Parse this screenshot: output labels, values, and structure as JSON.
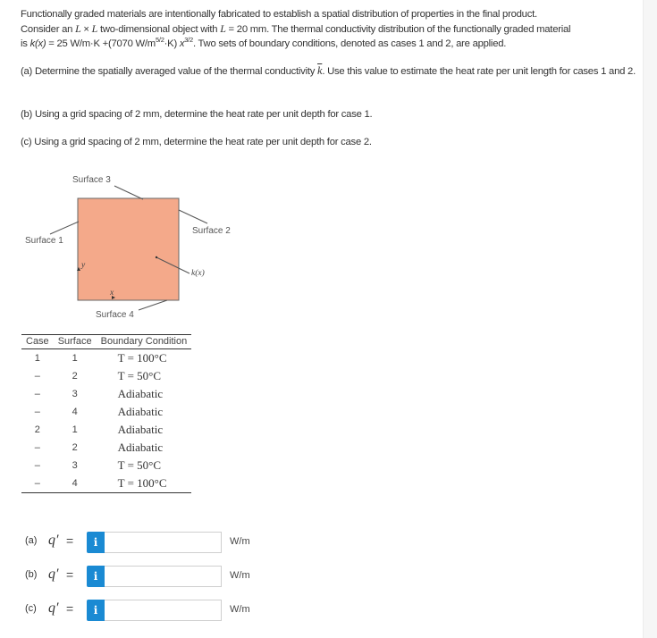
{
  "problem": {
    "intro_line1": "Functionally graded materials are intentionally fabricated to establish a spatial distribution of properties in the final product.",
    "intro_line2_a": "Consider an ",
    "intro_L": "L",
    "intro_times": " × ",
    "intro_L2": "L",
    "intro_line2_b": " two-dimensional object with ",
    "intro_L3": "L",
    "intro_line2_c": " = 20 mm. The thermal conductivity distribution of the functionally graded material",
    "intro_line3_a": "is ",
    "intro_kx": "k(x)",
    "intro_line3_b": " = 25 W/m·K +(7070 W/m",
    "intro_sup1": "5/2",
    "intro_line3_c": "·K) ",
    "intro_x": "x",
    "intro_sup2": "3/2",
    "intro_line3_d": ". Two sets of boundary conditions, denoted as cases 1 and 2, are applied.",
    "part_a_1": "(a) Determine the spatially averaged value of the thermal conductivity ",
    "part_a_k": "k",
    "part_a_2": ". Use this value to estimate the heat rate per unit length for cases 1 and 2.",
    "part_b": "(b) Using a grid spacing of 2 mm, determine the heat rate per unit depth for case 1.",
    "part_c": "(c) Using a grid spacing of 2 mm, determine the heat rate per unit depth for case 2."
  },
  "figure": {
    "surface1": "Surface 1",
    "surface2": "Surface 2",
    "surface3": "Surface 3",
    "surface4": "Surface 4",
    "k_label": "k(x)",
    "x_axis": "x",
    "y_axis": "y",
    "fill_color": "#f4a98a"
  },
  "table": {
    "headers": [
      "Case",
      "Surface",
      "Boundary Condition"
    ],
    "rows": [
      {
        "case": "1",
        "surface": "1",
        "condition": "T = 100°C"
      },
      {
        "case": "–",
        "surface": "2",
        "condition": "T = 50°C"
      },
      {
        "case": "–",
        "surface": "3",
        "condition": "Adiabatic"
      },
      {
        "case": "–",
        "surface": "4",
        "condition": "Adiabatic"
      },
      {
        "case": "2",
        "surface": "1",
        "condition": "Adiabatic"
      },
      {
        "case": "–",
        "surface": "2",
        "condition": "Adiabatic"
      },
      {
        "case": "–",
        "surface": "3",
        "condition": "T = 50°C"
      },
      {
        "case": "–",
        "surface": "4",
        "condition": "T = 100°C"
      }
    ]
  },
  "answers": [
    {
      "label": "(a)",
      "symbol": "q′",
      "eq": "=",
      "info": "i",
      "value": "",
      "unit": "W/m"
    },
    {
      "label": "(b)",
      "symbol": "q′",
      "eq": "=",
      "info": "i",
      "value": "",
      "unit": "W/m"
    },
    {
      "label": "(c)",
      "symbol": "q′",
      "eq": "=",
      "info": "i",
      "value": "",
      "unit": "W/m"
    }
  ],
  "colors": {
    "info_button": "#1a8ad3"
  }
}
